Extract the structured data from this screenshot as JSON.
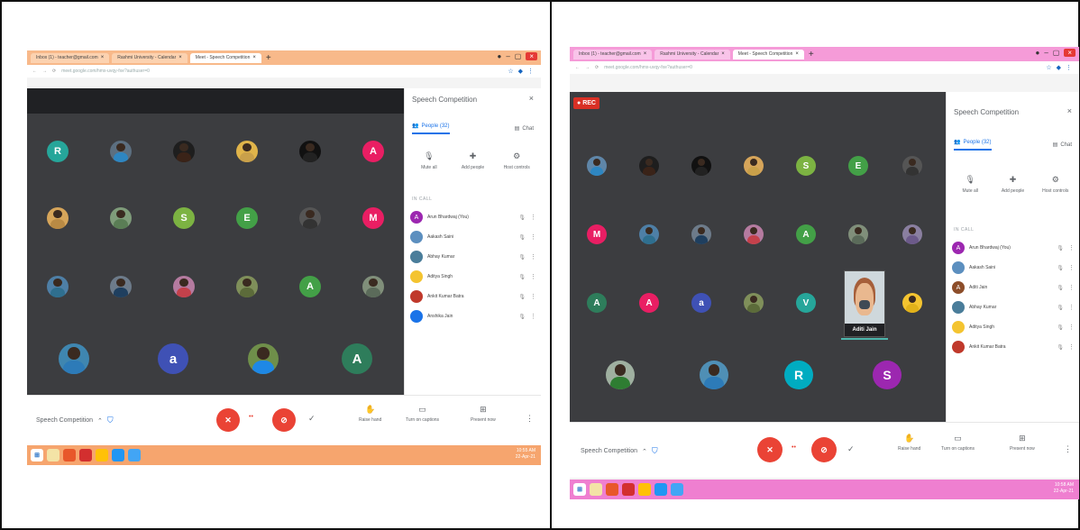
{
  "colors": {
    "tab_orange": "#f8b98a",
    "tab_pink": "#f59bd8",
    "stage": "#3c3d40",
    "accent": "#1a73e8",
    "danger": "#ea4335",
    "taskbar_left": "#f6a56e",
    "taskbar_right": "#ef7fd0"
  },
  "left": {
    "tabs": [
      {
        "label": "Inbox (1) - teacher@gmail.com"
      },
      {
        "label": "Rashmi University - Calendar"
      },
      {
        "label": "Meet - Speech Competition"
      }
    ],
    "url": "meet.google.com/hmx-uvqy-fxe?authuser=0",
    "panel": {
      "title": "Speech Competition",
      "people_tab": "People (32)",
      "chat_tab": "Chat",
      "actions": [
        {
          "label": "Mute all",
          "icon": "mic-off-icon"
        },
        {
          "label": "Add people",
          "icon": "add-person-icon"
        },
        {
          "label": "Host controls",
          "icon": "host-controls-icon"
        }
      ],
      "section": "IN CALL",
      "participants": [
        {
          "name": "Arun Bhardwaj (You)",
          "initial": "A",
          "color": "#9c27b0"
        },
        {
          "name": "Aakash Saini",
          "initial": "",
          "color": "#5c8fbf"
        },
        {
          "name": "Abhay Kumar",
          "initial": "",
          "color": "#4a7d9a"
        },
        {
          "name": "Aditya Singh",
          "initial": "",
          "color": "#f4c430"
        },
        {
          "name": "Ankit Kumar Batra",
          "initial": "",
          "color": "#c0392b"
        },
        {
          "name": "Anshika Jain",
          "initial": "",
          "color": "#1a73e8"
        }
      ]
    },
    "meeting_name": "Speech Competition",
    "bottom_actions": [
      {
        "label": "Raise hand",
        "icon": "hand-icon"
      },
      {
        "label": "Turn on captions",
        "icon": "captions-icon"
      },
      {
        "label": "Present now",
        "icon": "present-icon"
      }
    ],
    "tray_time": "10:55 AM",
    "tray_date": "22-Apr-21",
    "grid": [
      {
        "letter": "R",
        "color": "#26a69a",
        "photo": false
      },
      {
        "letter": "",
        "color": "#5c6f80",
        "photo": true,
        "body": "#2e86c1"
      },
      {
        "letter": "",
        "color": "#1e1e1e",
        "photo": true,
        "body": "#3a2318"
      },
      {
        "letter": "",
        "color": "#e0b44a",
        "photo": true,
        "body": "#c9a04a"
      },
      {
        "letter": "",
        "color": "#111111",
        "photo": true,
        "body": "#222"
      },
      {
        "letter": "A",
        "color": "#e91e63",
        "photo": false
      },
      {
        "letter": "",
        "color": "#d6a55a",
        "photo": true,
        "body": "#b98a44"
      },
      {
        "letter": "",
        "color": "#7f9c7a",
        "photo": true,
        "body": "#5a7d55"
      },
      {
        "letter": "S",
        "color": "#7cb342",
        "photo": false
      },
      {
        "letter": "E",
        "color": "#43a047",
        "photo": false
      },
      {
        "letter": "",
        "color": "#555",
        "photo": true,
        "body": "#333"
      },
      {
        "letter": "M",
        "color": "#e91e63",
        "photo": false
      },
      {
        "letter": "",
        "color": "#4e7fa6",
        "photo": true,
        "body": "#2f6f8f"
      },
      {
        "letter": "",
        "color": "#6d7b8a",
        "photo": true,
        "body": "#1f3f5f"
      },
      {
        "letter": "",
        "color": "#b57ba0",
        "photo": true,
        "body": "#c4414b"
      },
      {
        "letter": "",
        "color": "#7f8f5a",
        "photo": true,
        "body": "#5c6b3a"
      },
      {
        "letter": "A",
        "color": "#43a047",
        "photo": false
      },
      {
        "letter": "",
        "color": "#808f7a",
        "photo": true,
        "body": "#5b6b5a"
      },
      {
        "letter": "",
        "color": "#3f86b0",
        "photo": true,
        "body": "#2d7bb8"
      },
      {
        "letter": "a",
        "color": "#3f51b5",
        "photo": false
      },
      {
        "letter": "",
        "color": "#6f8f4a",
        "photo": true,
        "body": "#1e88e5"
      },
      {
        "letter": "A",
        "color": "#2e7d5b",
        "photo": false
      }
    ]
  },
  "right": {
    "tabs": [
      {
        "label": "Inbox (1) - teacher@gmail.com"
      },
      {
        "label": "Rashmi University - Calendar"
      },
      {
        "label": "Meet - Speech Competition"
      }
    ],
    "url": "meet.google.com/hmx-uvqy-fxe?authuser=0",
    "rec": "REC",
    "panel": {
      "title": "Speech Competition",
      "people_tab": "People (32)",
      "chat_tab": "Chat",
      "actions": [
        {
          "label": "Mute all",
          "icon": "mic-off-icon"
        },
        {
          "label": "Add people",
          "icon": "add-person-icon"
        },
        {
          "label": "Host controls",
          "icon": "host-controls-icon"
        }
      ],
      "section": "IN CALL",
      "participants": [
        {
          "name": "Arun Bhardwaj (You)",
          "initial": "A",
          "color": "#9c27b0"
        },
        {
          "name": "Aakash Saini",
          "initial": "",
          "color": "#5c8fbf"
        },
        {
          "name": "Aditi Jain",
          "initial": "A",
          "color": "#8d4e2a"
        },
        {
          "name": "Abhay Kumar",
          "initial": "",
          "color": "#4a7d9a"
        },
        {
          "name": "Aditya Singh",
          "initial": "",
          "color": "#f4c430"
        },
        {
          "name": "Ankit Kumar Batra",
          "initial": "",
          "color": "#c0392b"
        }
      ]
    },
    "meeting_name": "Speech Competition",
    "bottom_actions": [
      {
        "label": "Raise hand",
        "icon": "hand-icon"
      },
      {
        "label": "Turn on captions",
        "icon": "captions-icon"
      },
      {
        "label": "Present now",
        "icon": "present-icon"
      }
    ],
    "tray_time": "10:58 AM",
    "tray_date": "22-Apr-21",
    "video_label": "Aditi Jain",
    "grid": [
      {
        "letter": "",
        "color": "#5f86a8",
        "photo": true,
        "body": "#2e86c1"
      },
      {
        "letter": "",
        "color": "#1e1e1e",
        "photo": true,
        "body": "#3a2318"
      },
      {
        "letter": "",
        "color": "#111",
        "photo": true,
        "body": "#222"
      },
      {
        "letter": "",
        "color": "#d6a55a",
        "photo": true,
        "body": "#c9a04a"
      },
      {
        "letter": "S",
        "color": "#7cb342",
        "photo": false
      },
      {
        "letter": "E",
        "color": "#43a047",
        "photo": false
      },
      {
        "letter": "",
        "color": "#555",
        "photo": true,
        "body": "#333"
      },
      {
        "letter": "M",
        "color": "#e91e63",
        "photo": false
      },
      {
        "letter": "",
        "color": "#4e7fa6",
        "photo": true,
        "body": "#2f6f8f"
      },
      {
        "letter": "",
        "color": "#6d7b8a",
        "photo": true,
        "body": "#1f3f5f"
      },
      {
        "letter": "",
        "color": "#b57ba0",
        "photo": true,
        "body": "#c4414b"
      },
      {
        "letter": "A",
        "color": "#43a047",
        "photo": false
      },
      {
        "letter": "",
        "color": "#808f7a",
        "photo": true,
        "body": "#5b6b5a"
      },
      {
        "letter": "",
        "color": "#8a7fa0",
        "photo": true,
        "body": "#6c5a8a"
      },
      {
        "letter": "A",
        "color": "#2e7d5b",
        "photo": false
      },
      {
        "letter": "A",
        "color": "#e91e63",
        "photo": false
      },
      {
        "letter": "a",
        "color": "#3f51b5",
        "photo": false
      },
      {
        "letter": "",
        "color": "#7f8f5a",
        "photo": true,
        "body": "#5c6b3a"
      },
      {
        "letter": "V",
        "color": "#26a69a",
        "photo": false
      },
      {
        "letter": "",
        "color": "#f4c430",
        "photo": true,
        "body": "#e2b21a"
      },
      {
        "letter": "",
        "color": "#9fb0a0",
        "photo": true,
        "body": "#2e7d32"
      },
      {
        "letter": "",
        "color": "#4f8fb5",
        "photo": true,
        "body": "#2d7bb8"
      },
      {
        "letter": "R",
        "color": "#00acc1",
        "photo": false
      },
      {
        "letter": "S",
        "color": "#9c27b0",
        "photo": false
      }
    ]
  },
  "taskbar_icons": [
    {
      "name": "search",
      "color": "#f3e3a6"
    },
    {
      "name": "firefox",
      "color": "#e8572a"
    },
    {
      "name": "pdf",
      "color": "#d32f2f"
    },
    {
      "name": "chrome",
      "color": "#ffc107"
    },
    {
      "name": "edge",
      "color": "#2196f3"
    },
    {
      "name": "store",
      "color": "#42a5f5"
    }
  ]
}
